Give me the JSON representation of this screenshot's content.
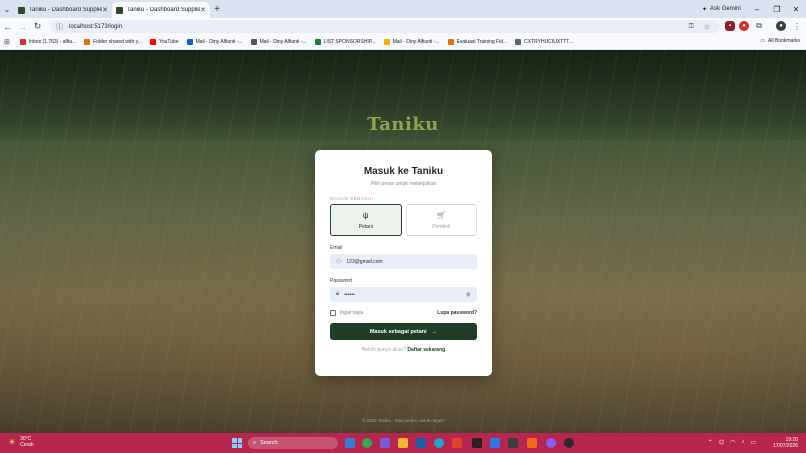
{
  "browser": {
    "tabs": [
      {
        "title": "Taniku - Dashboard Supplier",
        "active": false
      },
      {
        "title": "Taniku - Dashboard Supplier",
        "active": true
      }
    ],
    "ask_gemini": "Ask Gemini",
    "url": "localhost:5173/login",
    "bookmarks": [
      {
        "label": "Inbox (1.763) - alfia...",
        "color": "#d93025"
      },
      {
        "label": "Folder shared with y...",
        "color": "#e37400"
      },
      {
        "label": "YouTube",
        "color": "#ff0000"
      },
      {
        "label": "Mail - Diny Alfianti -...",
        "color": "#0a66c2"
      },
      {
        "label": "Mail - Diny Alfianti -...",
        "color": "#555555"
      },
      {
        "label": "LIST SPONSORSHIP...",
        "color": "#188038"
      },
      {
        "label": "Mail - Diny Alfianti -...",
        "color": "#f4b400"
      },
      {
        "label": "Evaluasi Training Fid...",
        "color": "#e8710a"
      },
      {
        "label": "CXTRYHUCIUXTTT...",
        "color": "#5f6368"
      }
    ],
    "all_bookmarks": "All Bookmarks"
  },
  "page": {
    "brand": "Taniku",
    "title": "Masuk ke Taniku",
    "subtitle": "Pilih peran untuk melanjutkan",
    "role_section_label": "MASUK SEBAGAI",
    "roles": [
      {
        "label": "Petani",
        "selected": true
      },
      {
        "label": "Pembeli",
        "selected": false
      }
    ],
    "email_label": "Email",
    "email_value": "123@gmail.com",
    "password_label": "Password",
    "password_value": "••••••",
    "remember_label": "Ingat saya",
    "forgot_label": "Lupa password?",
    "submit_label": "Masuk sebagai petani",
    "register_prompt": "Belum punya akun?",
    "register_link": "Daftar sekarang",
    "footer": "© 2026 Taniku · Dari petani, untuk negeri"
  },
  "taskbar": {
    "temp": "30°C",
    "weather": "Cerah",
    "search_placeholder": "Search",
    "time": "19:20",
    "date": "17/07/2026"
  },
  "colors": {
    "accent": "#1f3d27",
    "taskbar": "#b7264f",
    "brand": "#8fa352"
  }
}
